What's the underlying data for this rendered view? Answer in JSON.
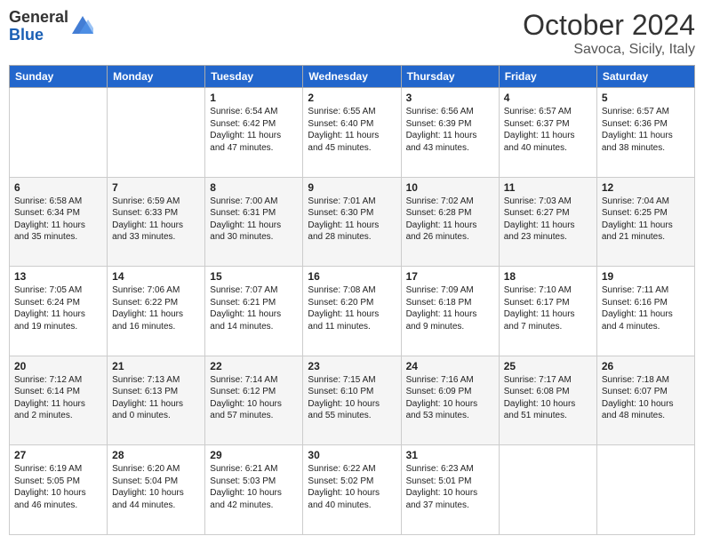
{
  "header": {
    "logo_general": "General",
    "logo_blue": "Blue",
    "month": "October 2024",
    "location": "Savoca, Sicily, Italy"
  },
  "weekdays": [
    "Sunday",
    "Monday",
    "Tuesday",
    "Wednesday",
    "Thursday",
    "Friday",
    "Saturday"
  ],
  "rows": [
    [
      {
        "day": "",
        "text": ""
      },
      {
        "day": "",
        "text": ""
      },
      {
        "day": "1",
        "text": "Sunrise: 6:54 AM\nSunset: 6:42 PM\nDaylight: 11 hours and 47 minutes."
      },
      {
        "day": "2",
        "text": "Sunrise: 6:55 AM\nSunset: 6:40 PM\nDaylight: 11 hours and 45 minutes."
      },
      {
        "day": "3",
        "text": "Sunrise: 6:56 AM\nSunset: 6:39 PM\nDaylight: 11 hours and 43 minutes."
      },
      {
        "day": "4",
        "text": "Sunrise: 6:57 AM\nSunset: 6:37 PM\nDaylight: 11 hours and 40 minutes."
      },
      {
        "day": "5",
        "text": "Sunrise: 6:57 AM\nSunset: 6:36 PM\nDaylight: 11 hours and 38 minutes."
      }
    ],
    [
      {
        "day": "6",
        "text": "Sunrise: 6:58 AM\nSunset: 6:34 PM\nDaylight: 11 hours and 35 minutes."
      },
      {
        "day": "7",
        "text": "Sunrise: 6:59 AM\nSunset: 6:33 PM\nDaylight: 11 hours and 33 minutes."
      },
      {
        "day": "8",
        "text": "Sunrise: 7:00 AM\nSunset: 6:31 PM\nDaylight: 11 hours and 30 minutes."
      },
      {
        "day": "9",
        "text": "Sunrise: 7:01 AM\nSunset: 6:30 PM\nDaylight: 11 hours and 28 minutes."
      },
      {
        "day": "10",
        "text": "Sunrise: 7:02 AM\nSunset: 6:28 PM\nDaylight: 11 hours and 26 minutes."
      },
      {
        "day": "11",
        "text": "Sunrise: 7:03 AM\nSunset: 6:27 PM\nDaylight: 11 hours and 23 minutes."
      },
      {
        "day": "12",
        "text": "Sunrise: 7:04 AM\nSunset: 6:25 PM\nDaylight: 11 hours and 21 minutes."
      }
    ],
    [
      {
        "day": "13",
        "text": "Sunrise: 7:05 AM\nSunset: 6:24 PM\nDaylight: 11 hours and 19 minutes."
      },
      {
        "day": "14",
        "text": "Sunrise: 7:06 AM\nSunset: 6:22 PM\nDaylight: 11 hours and 16 minutes."
      },
      {
        "day": "15",
        "text": "Sunrise: 7:07 AM\nSunset: 6:21 PM\nDaylight: 11 hours and 14 minutes."
      },
      {
        "day": "16",
        "text": "Sunrise: 7:08 AM\nSunset: 6:20 PM\nDaylight: 11 hours and 11 minutes."
      },
      {
        "day": "17",
        "text": "Sunrise: 7:09 AM\nSunset: 6:18 PM\nDaylight: 11 hours and 9 minutes."
      },
      {
        "day": "18",
        "text": "Sunrise: 7:10 AM\nSunset: 6:17 PM\nDaylight: 11 hours and 7 minutes."
      },
      {
        "day": "19",
        "text": "Sunrise: 7:11 AM\nSunset: 6:16 PM\nDaylight: 11 hours and 4 minutes."
      }
    ],
    [
      {
        "day": "20",
        "text": "Sunrise: 7:12 AM\nSunset: 6:14 PM\nDaylight: 11 hours and 2 minutes."
      },
      {
        "day": "21",
        "text": "Sunrise: 7:13 AM\nSunset: 6:13 PM\nDaylight: 11 hours and 0 minutes."
      },
      {
        "day": "22",
        "text": "Sunrise: 7:14 AM\nSunset: 6:12 PM\nDaylight: 10 hours and 57 minutes."
      },
      {
        "day": "23",
        "text": "Sunrise: 7:15 AM\nSunset: 6:10 PM\nDaylight: 10 hours and 55 minutes."
      },
      {
        "day": "24",
        "text": "Sunrise: 7:16 AM\nSunset: 6:09 PM\nDaylight: 10 hours and 53 minutes."
      },
      {
        "day": "25",
        "text": "Sunrise: 7:17 AM\nSunset: 6:08 PM\nDaylight: 10 hours and 51 minutes."
      },
      {
        "day": "26",
        "text": "Sunrise: 7:18 AM\nSunset: 6:07 PM\nDaylight: 10 hours and 48 minutes."
      }
    ],
    [
      {
        "day": "27",
        "text": "Sunrise: 6:19 AM\nSunset: 5:05 PM\nDaylight: 10 hours and 46 minutes."
      },
      {
        "day": "28",
        "text": "Sunrise: 6:20 AM\nSunset: 5:04 PM\nDaylight: 10 hours and 44 minutes."
      },
      {
        "day": "29",
        "text": "Sunrise: 6:21 AM\nSunset: 5:03 PM\nDaylight: 10 hours and 42 minutes."
      },
      {
        "day": "30",
        "text": "Sunrise: 6:22 AM\nSunset: 5:02 PM\nDaylight: 10 hours and 40 minutes."
      },
      {
        "day": "31",
        "text": "Sunrise: 6:23 AM\nSunset: 5:01 PM\nDaylight: 10 hours and 37 minutes."
      },
      {
        "day": "",
        "text": ""
      },
      {
        "day": "",
        "text": ""
      }
    ]
  ]
}
